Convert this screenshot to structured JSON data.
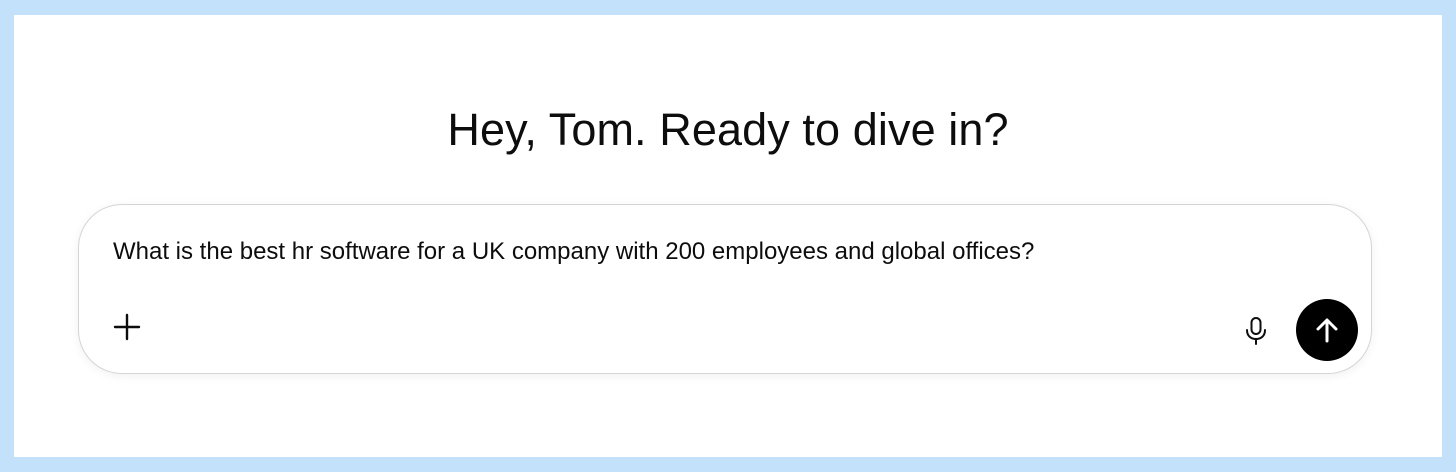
{
  "greeting": "Hey, Tom. Ready to dive in?",
  "composer": {
    "input_value": "What is the best hr software for a UK company with 200 employees and global offices?",
    "add_icon": "plus-icon",
    "mic_icon": "microphone-icon",
    "send_icon": "arrow-up-icon"
  },
  "colors": {
    "page_border": "#c3e1fb",
    "background": "#ffffff",
    "text": "#0d0d0d",
    "send_button": "#000000"
  }
}
